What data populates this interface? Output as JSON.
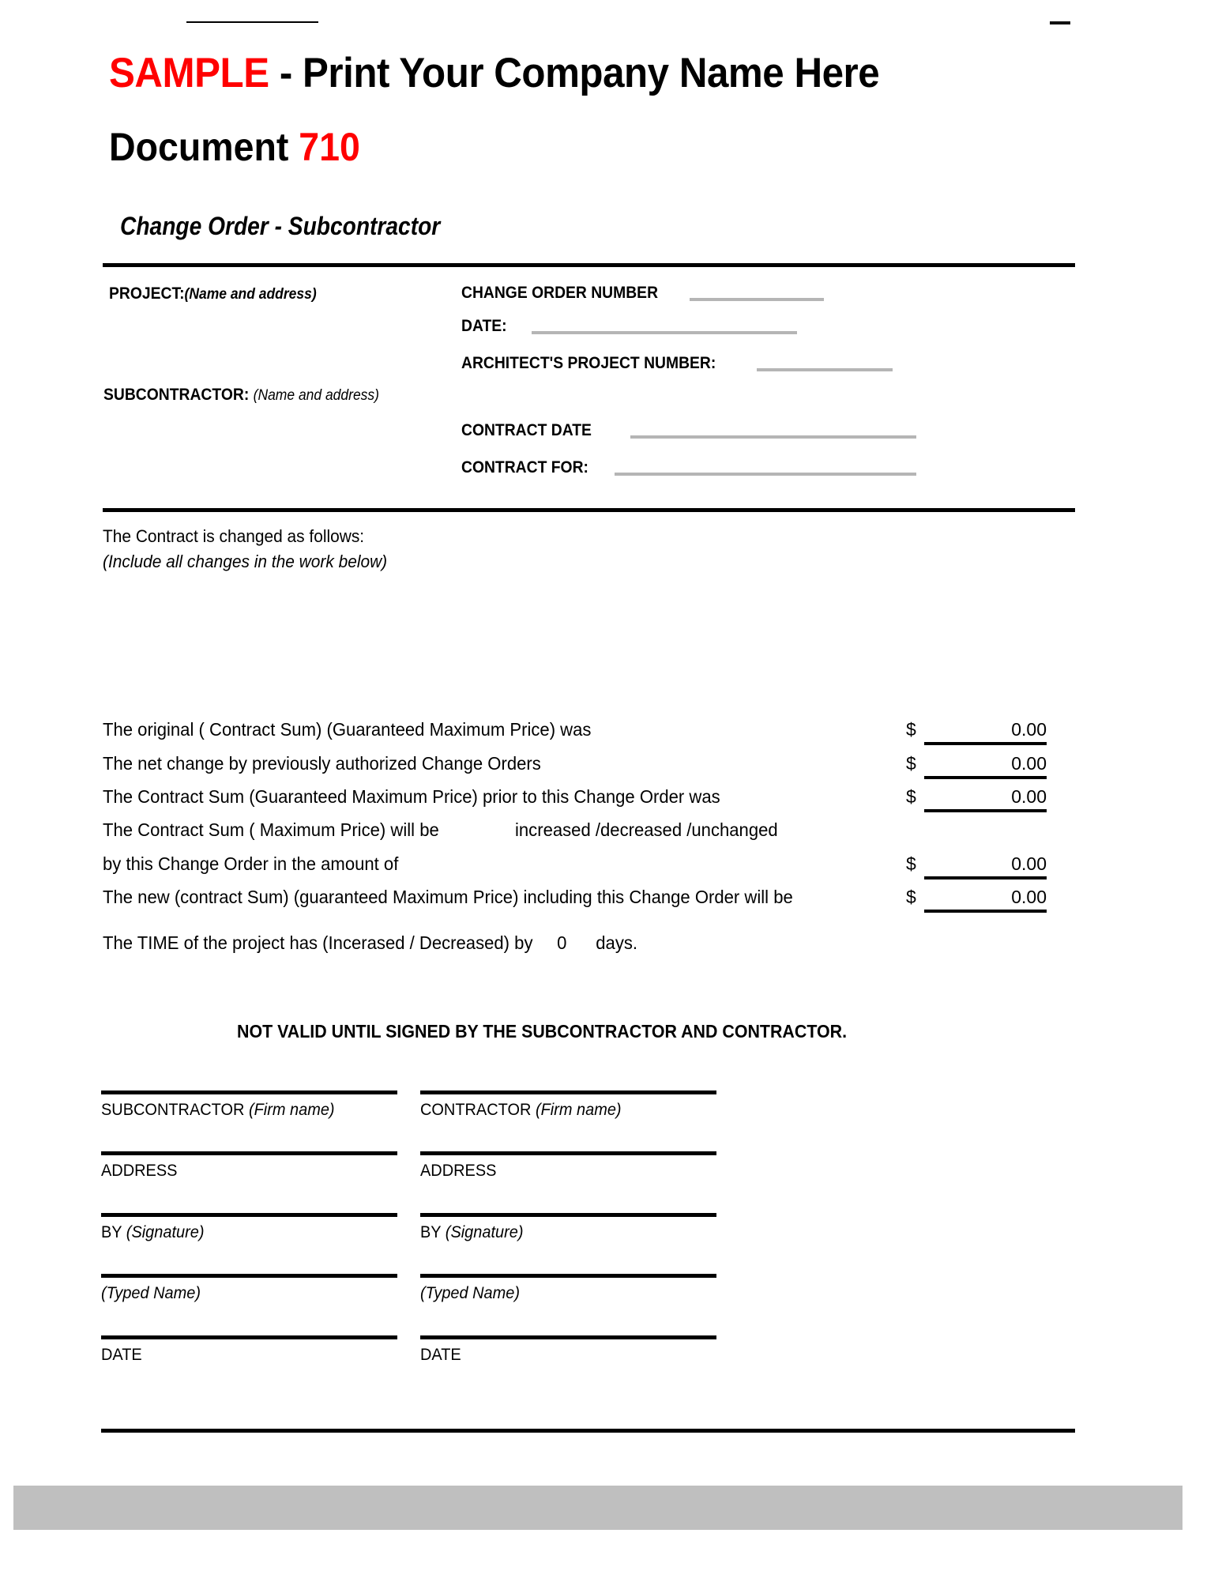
{
  "header": {
    "sample_word": "SAMPLE",
    "title_rest": " - Print Your Company Name Here",
    "document_word": "Document",
    "document_number": "710",
    "subtitle": "Change Order - Subcontractor",
    "sample_color": "#FF0000"
  },
  "fields": {
    "project_label": "PROJECT:",
    "project_hint": "(Name and address)",
    "subcontractor_label": "SUBCONTRACTOR:",
    "subcontractor_hint": "(Name and address)",
    "change_order_number_label": "CHANGE ORDER NUMBER",
    "date_label": "DATE:",
    "architects_project_number_label": "ARCHITECT'S PROJECT NUMBER:",
    "contract_date_label": "CONTRACT DATE",
    "contract_for_label": "CONTRACT FOR:",
    "change_order_number_value": "",
    "date_value": "",
    "architects_project_number_value": "",
    "contract_date_value": "",
    "contract_for_value": ""
  },
  "changes": {
    "line1": "The Contract is changed as follows:",
    "line2": "(Include all changes in the work below)"
  },
  "amounts": {
    "rows": [
      {
        "label": "The original ( Contract Sum)  (Guaranteed Maximum Price) was",
        "currency": "$",
        "value": "0.00"
      },
      {
        "label": "The net change by previously authorized Change Orders",
        "currency": "$",
        "value": "0.00"
      },
      {
        "label": "The Contract Sum (Guaranteed Maximum Price) prior to this Change Order was",
        "currency": "$",
        "value": "0.00"
      },
      {
        "label": "The Contract Sum ( Maximum Price) will be",
        "currency": "",
        "value": ""
      },
      {
        "label": "by this Change Order in the amount of",
        "currency": "$",
        "value": "0.00"
      },
      {
        "label": "The new (contract Sum) (guaranteed Maximum Price) including this Change Order will be",
        "currency": "$",
        "value": "0.00"
      }
    ],
    "increase_options": "increased /decreased /unchanged",
    "time_statement_pre": "The TIME of the project has   (Incerased / Decreased)   by",
    "time_days_value": "0",
    "time_statement_post": "days."
  },
  "notice": {
    "text": "NOT VALID UNTIL SIGNED BY THE SUBCONTRACTOR AND CONTRACTOR."
  },
  "signatures": {
    "left_column": [
      {
        "label": "SUBCONTRACTOR ",
        "hint": "(Firm name)"
      },
      {
        "label": "ADDRESS",
        "hint": ""
      },
      {
        "label": "BY ",
        "hint": "(Signature)"
      },
      {
        "label": "",
        "hint": "(Typed Name)"
      },
      {
        "label": "DATE",
        "hint": ""
      }
    ],
    "right_column": [
      {
        "label": "CONTRACTOR ",
        "hint": "(Firm name)"
      },
      {
        "label": "ADDRESS",
        "hint": ""
      },
      {
        "label": "BY ",
        "hint": "(Signature)"
      },
      {
        "label": "",
        "hint": "(Typed Name)"
      },
      {
        "label": "DATE",
        "hint": ""
      }
    ]
  }
}
